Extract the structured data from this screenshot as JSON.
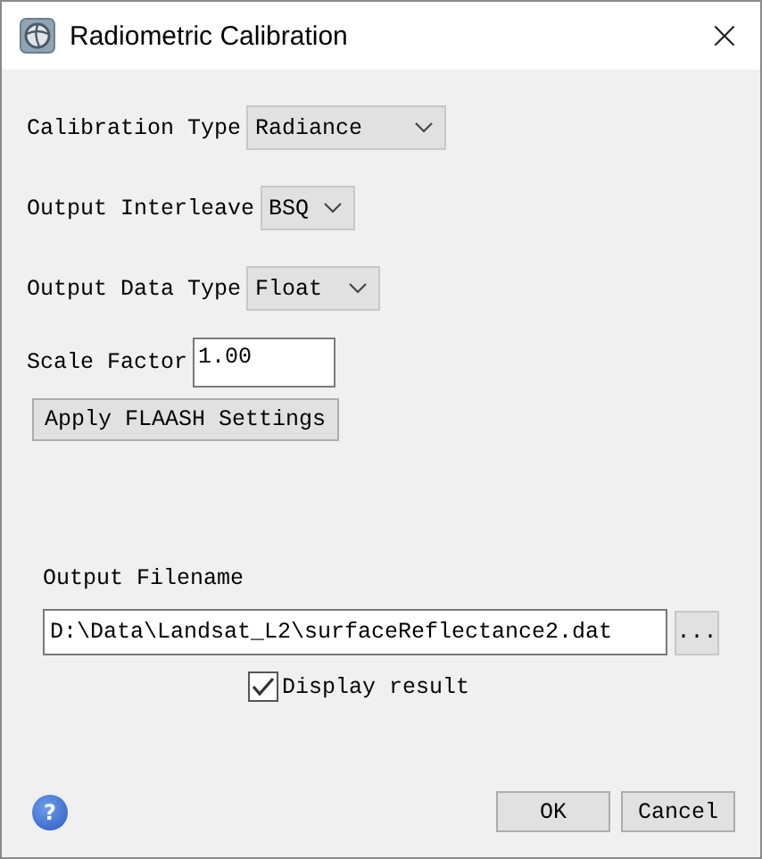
{
  "window": {
    "title": "Radiometric Calibration",
    "close": "×"
  },
  "fields": [
    {
      "kind": "dropdown",
      "label": "Calibration Type",
      "value": "Radiance"
    },
    {
      "kind": "dropdown",
      "label": "Output Interleave",
      "value": "BSQ"
    },
    {
      "kind": "dropdown",
      "label": "Output Data Type",
      "value": "Float"
    },
    {
      "kind": "text",
      "label": "Scale Factor",
      "value": "1.00"
    }
  ],
  "apply_button": "Apply FLAASH Settings",
  "output": {
    "label": "Output Filename",
    "value": "D:\\Data\\Landsat_L2\\surfaceReflectance2.dat",
    "browse": "..."
  },
  "display_result": {
    "label": "Display result",
    "checked": true
  },
  "help": "?",
  "buttons": [
    "OK",
    "Cancel"
  ]
}
